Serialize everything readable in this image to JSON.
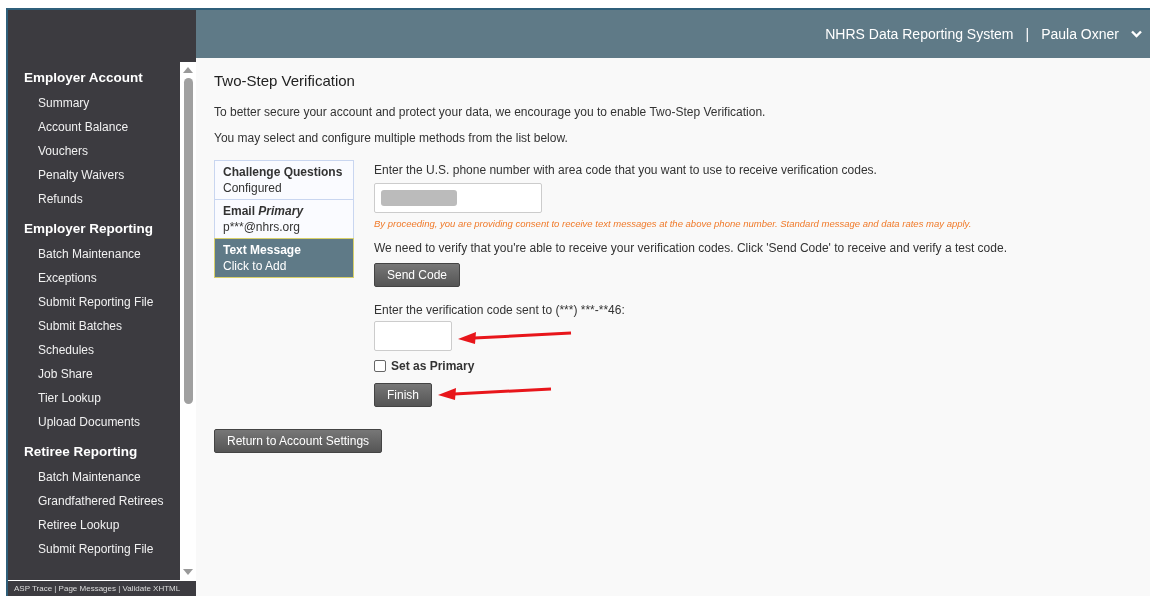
{
  "header": {
    "system_name": "NHRS Data Reporting System",
    "separator": "|",
    "user_name": "Paula Oxner"
  },
  "sidebar": {
    "sections": [
      {
        "title": "Employer Account",
        "items": [
          "Summary",
          "Account Balance",
          "Vouchers",
          "Penalty Waivers",
          "Refunds"
        ]
      },
      {
        "title": "Employer Reporting",
        "items": [
          "Batch Maintenance",
          "Exceptions",
          "Submit Reporting File",
          "Submit Batches",
          "Schedules",
          "Job Share",
          "Tier Lookup",
          "Upload Documents"
        ]
      },
      {
        "title": "Retiree Reporting",
        "items": [
          "Batch Maintenance",
          "Grandfathered Retirees",
          "Retiree Lookup",
          "Submit Reporting File"
        ]
      }
    ],
    "footer": "ASP Trace | Page Messages | Validate XHTML"
  },
  "page": {
    "title": "Two-Step Verification",
    "intro": [
      "To better secure your account and protect your data, we encourage you to enable Two-Step Verification.",
      "You may select and configure multiple methods from the list below."
    ],
    "methods": [
      {
        "title": "Challenge Questions",
        "subtitle": "Configured",
        "selected": false
      },
      {
        "title": "Email *Primary*",
        "subtitle": "p***@nhrs.org",
        "selected": false
      },
      {
        "title": "Text Message",
        "subtitle": "Click to Add",
        "selected": true
      }
    ],
    "phone_label": "Enter the U.S. phone number with area code that you want to use to receive verification codes.",
    "consent": "By proceeding, you are providing consent to receive text messages at the above phone number. Standard message and data rates may apply.",
    "verify_text": "We need to verify that you're able to receive your verification codes. Click 'Send Code' to receive and verify a test code.",
    "send_button": "Send Code",
    "code_label": "Enter the verification code sent to (***) ***-**46:",
    "set_primary": {
      "label": "Set as Primary",
      "checked": false
    },
    "finish_button": "Finish",
    "return_button": "Return to Account Settings"
  }
}
